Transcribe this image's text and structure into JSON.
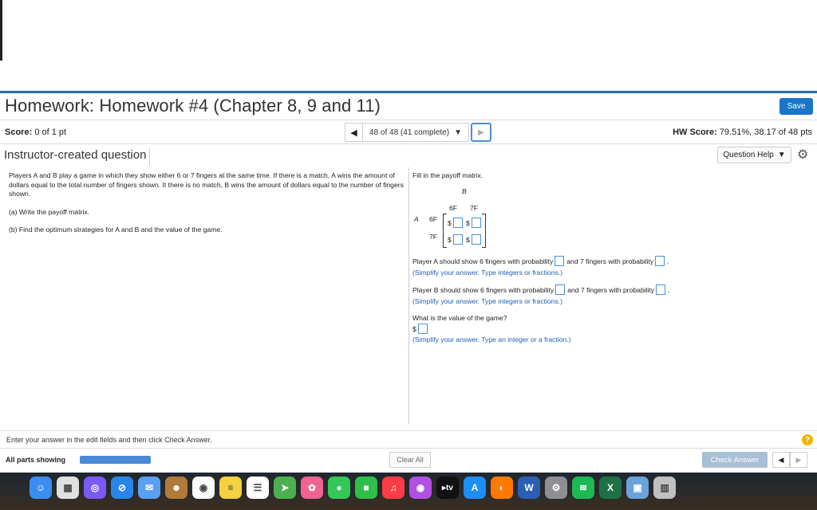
{
  "header": {
    "title": "Homework: Homework #4 (Chapter 8, 9 and 11)",
    "save_label": "Save"
  },
  "status": {
    "score_label": "Score:",
    "score_value": "0 of 1 pt",
    "position": "48 of 48 (41 complete)",
    "hw_score_label": "HW Score:",
    "hw_score_value": "79.51%, 38.17 of 48 pts"
  },
  "question": {
    "type": "Instructor-created question",
    "help_label": "Question Help",
    "prompt": "Players A and B play a game in which they show either 6 or 7 fingers at the same time.  If there is a match, A wins the amount of dollars equal to the total number of fingers shown.  It there is no match, B wins the amount of dollars equal to the number of fingers shown.",
    "part_a": "(a) Write the payoff matrix.",
    "part_b": "(b) Find the optimum strategies for A and B and the value of the game."
  },
  "answer": {
    "fill_in": "Fill in the payoff matrix.",
    "player_b": "B",
    "player_a": "A",
    "col1": "6F",
    "col2": "7F",
    "row1": "6F",
    "row2": "7F",
    "dollar": "$",
    "a_prob_1": "Player A should show 6 fingers with probability",
    "a_prob_2": "and 7 fingers with probability",
    "hint_simplify": "(Simplify your answer. Type integers or fractions.)",
    "b_prob_1": "Player B should show 6 fingers with probability",
    "b_prob_2": "and 7 fingers with probability",
    "value_question": "What is the value of the game?",
    "hint_value": "(Simplify your answer. Type an integer or a fraction.)",
    "period": "."
  },
  "footer": {
    "enter_text": "Enter your answer in the edit fields and then click Check Answer.",
    "all_parts": "All parts showing",
    "progress": 1.0,
    "clear_all": "Clear All",
    "check_answer": "Check Answer"
  },
  "dock": {
    "icons": [
      "finder-icon",
      "launchpad-icon",
      "siri-icon",
      "safari-icon",
      "mail-icon",
      "contacts-icon",
      "chrome-icon",
      "notes-icon",
      "reminders-icon",
      "maps-icon",
      "photos-icon",
      "messages-icon",
      "facetime-icon",
      "music-icon",
      "podcasts-icon",
      "tv-icon",
      "appstore-icon",
      "firefox-icon",
      "word-icon",
      "system-preferences-icon",
      "spotify-icon",
      "excel-icon",
      "preview-icon",
      "trash-icon"
    ],
    "tv_label": "tv"
  }
}
